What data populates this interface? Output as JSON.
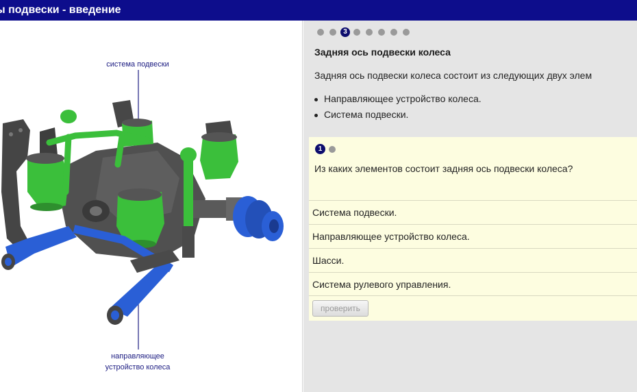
{
  "window": {
    "title": "ы подвески - введение"
  },
  "illustration": {
    "callout_top": "система подвески",
    "callout_bottom": "направляющее\nустройство колеса"
  },
  "lesson": {
    "pager": {
      "current": "3",
      "total_dots": 8,
      "current_index": 2
    },
    "heading": "Задняя ось подвески колеса",
    "intro": "Задняя ось подвески колеса состоит из следующих двух элем",
    "bullets": [
      "Направляющее устройство колеса.",
      "Система подвески."
    ]
  },
  "quiz": {
    "pager": {
      "current": "1",
      "total_dots": 2
    },
    "question": "Из каких элементов состоит задняя ось подвески колеса?",
    "options": [
      "Система подвески.",
      "Направляющее устройство колеса.",
      "Шасси.",
      "Система рулевого управления."
    ],
    "check_label": "проверить"
  },
  "colors": {
    "title_bar": "#0d0d8c",
    "pager_active": "#0d0d6e",
    "pager_inactive": "#9a9a9a",
    "quiz_background": "#fdfde0",
    "right_pane_background": "#e5e5e5",
    "callout_text": "#1a1a80",
    "suspension_green": "#3bbf3b",
    "guide_blue": "#2a5fd6",
    "frame_dark": "#4a4a4a"
  }
}
